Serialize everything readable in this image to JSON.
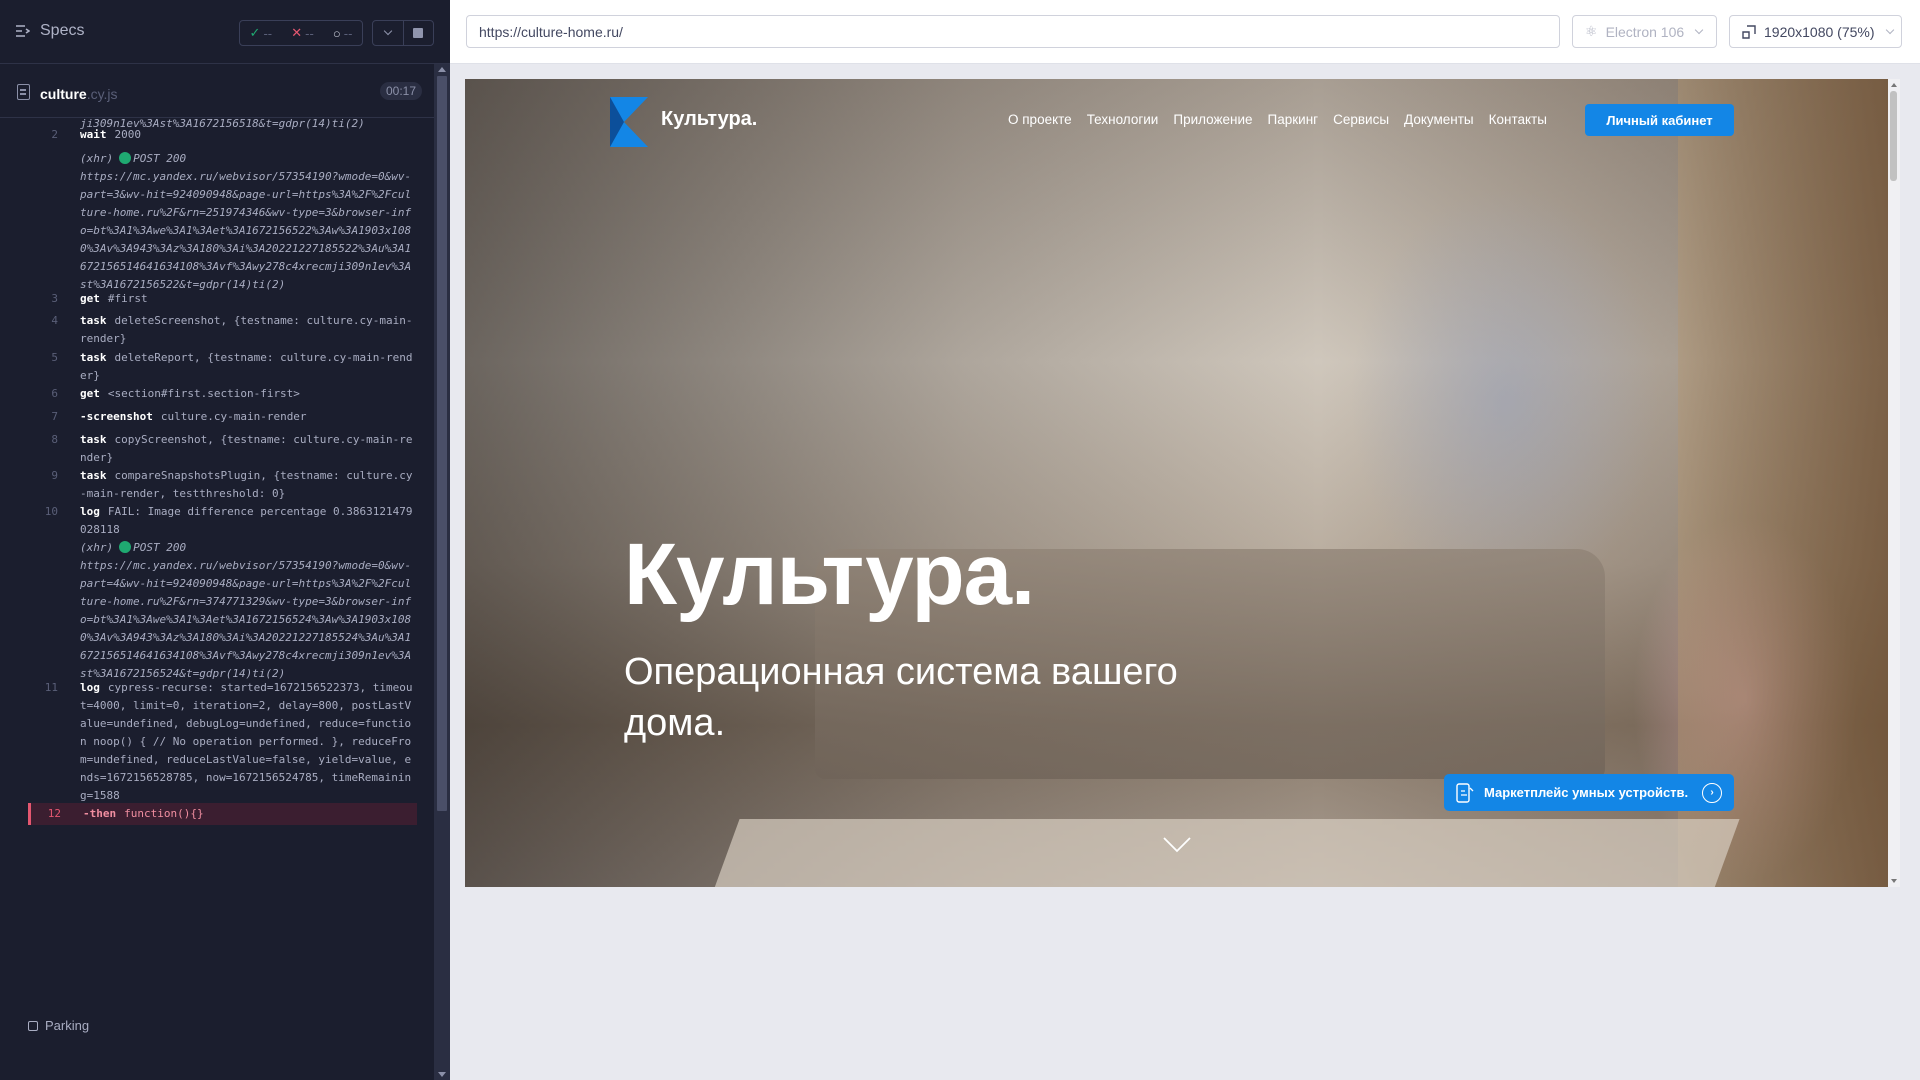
{
  "reporter": {
    "specs_label": "Specs",
    "stats": {
      "passed": "--",
      "failed": "--",
      "pending": "--"
    },
    "spec": {
      "name": "culture",
      "ext": ".cy.js",
      "time": "00:17"
    },
    "commands": [
      {
        "num": "",
        "name": "",
        "msg": "ji309n1ev%3Ast%3A1672156518&t=gdpr(14)ti(2)",
        "type": "cont"
      },
      {
        "num": "2",
        "name": "wait",
        "msg": "2000",
        "type": "cmd"
      },
      {
        "num": "",
        "name": "(xhr)",
        "status": "POST 200",
        "msg": "https://mc.yandex.ru/webvisor/57354190?wmode=0&wv-part=3&wv-hit=924090948&page-url=https%3A%2F%2Fculture-home.ru%2F&rn=251974346&wv-type=3&browser-info=bt%3A1%3Awe%3A1%3Aet%3A1672156522%3Aw%3A1903x1080%3Av%3A943%3Az%3A180%3Ai%3A20221227185522%3Au%3A1672156514641634108%3Avf%3Awy278c4xrecmji309n1ev%3Ast%3A1672156522&t=gdpr(14)ti(2)",
        "type": "xhr"
      },
      {
        "num": "3",
        "name": "get",
        "msg": "#first",
        "type": "cmd"
      },
      {
        "num": "4",
        "name": "task",
        "msg": "deleteScreenshot, {testname: culture.cy-main-render}",
        "type": "cmd"
      },
      {
        "num": "5",
        "name": "task",
        "msg": "deleteReport, {testname: culture.cy-main-render}",
        "type": "cmd"
      },
      {
        "num": "6",
        "name": "get",
        "msg": "<section#first.section-first>",
        "type": "cmd"
      },
      {
        "num": "7",
        "name": "-screenshot",
        "msg": "culture.cy-main-render",
        "type": "cmd"
      },
      {
        "num": "8",
        "name": "task",
        "msg": "copyScreenshot, {testname: culture.cy-main-render}",
        "type": "cmd"
      },
      {
        "num": "9",
        "name": "task",
        "msg": "compareSnapshotsPlugin, {testname: culture.cy-main-render, testthreshold: 0}",
        "type": "cmd"
      },
      {
        "num": "10",
        "name": "log",
        "msg": "FAIL: Image difference percentage 0.3863121479028118",
        "type": "cmd"
      },
      {
        "num": "",
        "name": "(xhr)",
        "status": "POST 200",
        "msg": "https://mc.yandex.ru/webvisor/57354190?wmode=0&wv-part=4&wv-hit=924090948&page-url=https%3A%2F%2Fculture-home.ru%2F&rn=374771329&wv-type=3&browser-info=bt%3A1%3Awe%3A1%3Aet%3A1672156524%3Aw%3A1903x1080%3Av%3A943%3Az%3A180%3Ai%3A20221227185524%3Au%3A1672156514641634108%3Avf%3Awy278c4xrecmji309n1ev%3Ast%3A1672156524&t=gdpr(14)ti(2)",
        "type": "xhr"
      },
      {
        "num": "11",
        "name": "log",
        "msg": "cypress-recurse: started=1672156522373, timeout=4000, limit=0, iteration=2, delay=800, postLastValue=undefined, debugLog=undefined, reduce=function noop() { // No operation performed. }, reduceFrom=undefined, reduceLastValue=false, yield=value, ends=1672156528785, now=1672156524785, timeRemaining=1588",
        "type": "cmd"
      },
      {
        "num": "12",
        "name": "-then",
        "msg": "function(){}",
        "type": "failed"
      }
    ],
    "parking_label": "Parking"
  },
  "aut": {
    "url": "https://culture-home.ru/",
    "browser": "Electron 106",
    "viewport": "1920x1080 (75%)"
  },
  "site": {
    "logo": "Культура.",
    "nav": [
      "О проекте",
      "Технологии",
      "Приложение",
      "Паркинг",
      "Сервисы",
      "Документы",
      "Контакты"
    ],
    "cabinet_button": "Личный кабинет",
    "hero_title": "Культура.",
    "hero_subtitle": "Операционная система вашего дома.",
    "market_button": "Маркетплейс умных устройств.",
    "colors": {
      "accent": "#1386e6",
      "reporter_bg": "#1b1e2e",
      "fail": "#e45770",
      "pass": "#1fa971"
    }
  }
}
